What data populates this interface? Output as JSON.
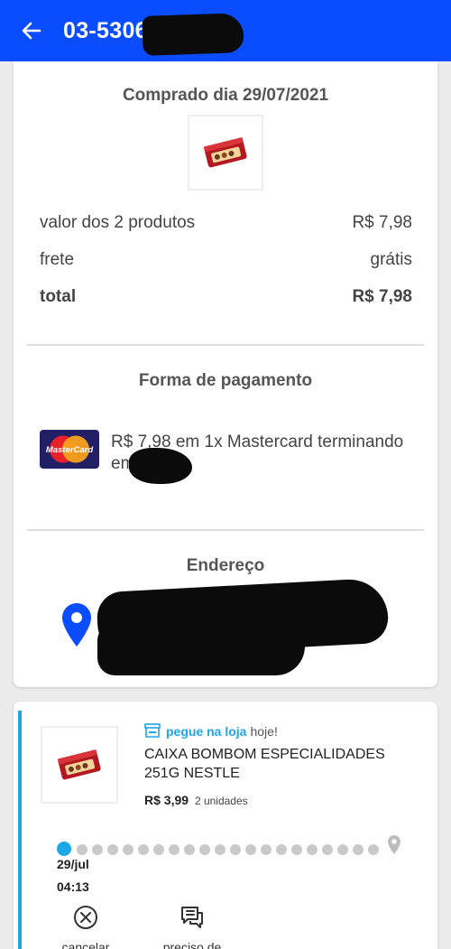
{
  "header": {
    "order_id": "03-5306",
    "colors": {
      "primary": "#0a4cff",
      "accent": "#1ea7e6"
    },
    "back_icon": "arrow-left-icon"
  },
  "summary": {
    "purchased_label": "Comprado dia 29/07/2021",
    "rows": [
      {
        "label": "valor dos 2 produtos",
        "value": "R$ 7,98"
      },
      {
        "label": "frete",
        "value": "grátis"
      },
      {
        "label": "total",
        "value": "R$ 7,98"
      }
    ]
  },
  "payment": {
    "title": "Forma de pagamento",
    "card_brand": "MasterCard",
    "description": "R$ 7,98 em 1x Mastercard terminando em"
  },
  "address": {
    "title": "Endereço",
    "icon": "location-pin-icon"
  },
  "item": {
    "pickup_label": "pegue na loja",
    "pickup_when": "hoje!",
    "name": "CAIXA BOMBOM ESPECIALIDADES 251G NESTLE",
    "price": "R$ 3,99",
    "units": "2 unidades",
    "timeline": {
      "date": "29/jul",
      "time": "04:13"
    },
    "actions": [
      {
        "label": "cancelar",
        "icon": "close-circle-icon"
      },
      {
        "label": "preciso de",
        "icon": "chat-icon"
      }
    ]
  }
}
